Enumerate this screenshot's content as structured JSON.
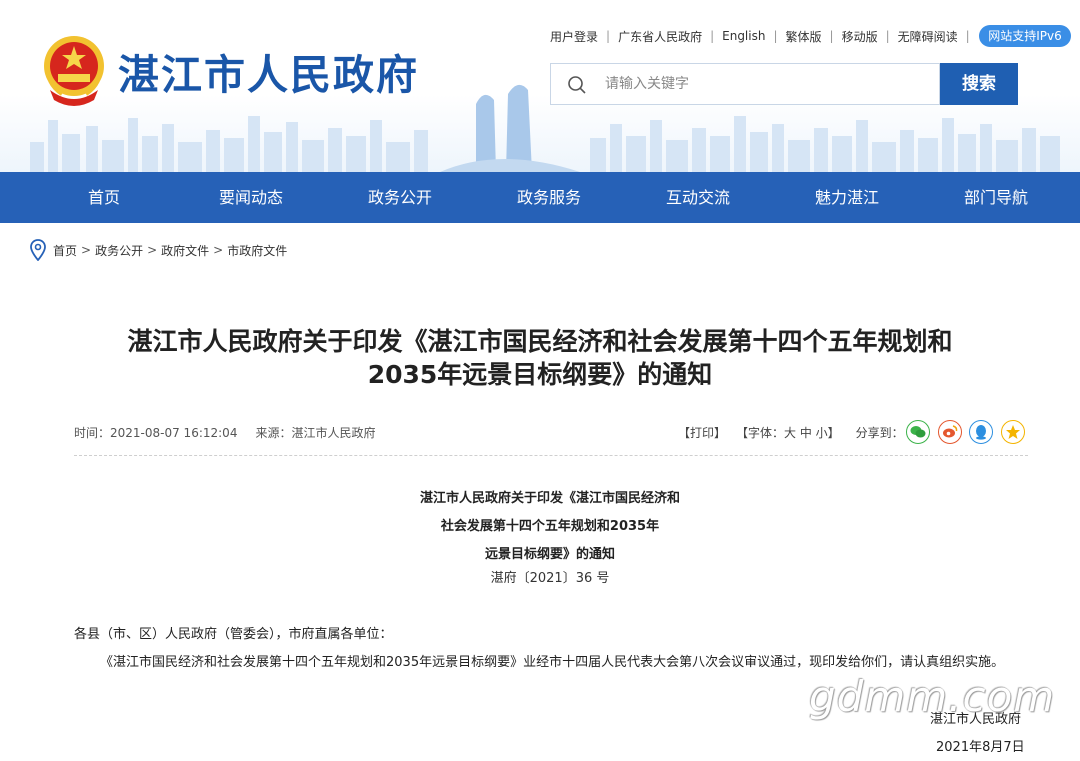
{
  "header": {
    "site_title": "湛江市人民政府",
    "top_links": [
      "用户登录",
      "广东省人民政府",
      "English",
      "繁体版",
      "移动版",
      "无障碍阅读"
    ],
    "ipv6_badge": "网站支持IPv6",
    "search": {
      "placeholder": "请输入关键字",
      "button_label": "搜索"
    }
  },
  "nav": {
    "items": [
      "首页",
      "要闻动态",
      "政务公开",
      "政务服务",
      "互动交流",
      "魅力湛江",
      "部门导航"
    ]
  },
  "breadcrumb": [
    "首页",
    "政务公开",
    "政府文件",
    "市政府文件"
  ],
  "article": {
    "title_line1": "湛江市人民政府关于印发《湛江市国民经济和社会发展第十四个五年规划和",
    "title_line2": "2035年远景目标纲要》的通知",
    "time": "时间：2021-08-07 16:12:04",
    "source": "来源：湛江市人民政府",
    "print_label": "【打印】",
    "font_size_label": "【字体：大 中 小】",
    "share_label": "分享到：",
    "share_icons": [
      "wechat-icon",
      "weibo-icon",
      "qq-icon",
      "qzone-icon"
    ],
    "doc_head_line1": "湛江市人民政府关于印发《湛江市国民经济和",
    "doc_head_line2": "社会发展第十四个五年规划和2035年",
    "doc_head_line3": "远景目标纲要》的通知",
    "doc_number": "湛府〔2021〕36 号",
    "salutation": "各县（市、区）人民政府（管委会），市府直属各单位：",
    "paragraph": "《湛江市国民经济和社会发展第十四个五年规划和2035年远景目标纲要》业经市十四届人民代表大会第八次会议审议通过，现印发给你们，请认真组织实施。",
    "signature_org": "湛江市人民政府",
    "signature_date": "2021年8月7日"
  },
  "watermark": "gdmm.com",
  "colors": {
    "brand_blue": "#1a56a8",
    "nav_blue": "#2661b7",
    "search_button": "#1f5fb2",
    "ipv6_badge": "#3a8ee6"
  }
}
